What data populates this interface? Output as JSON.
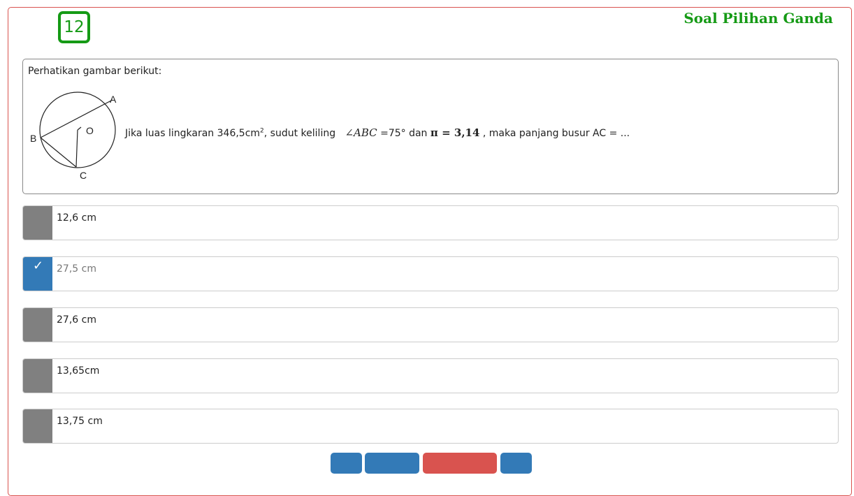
{
  "question": {
    "number": "12",
    "type_title": "Soal Pilihan Ganda",
    "intro": "Perhatikan gambar berikut:",
    "figure_labels": {
      "a": "A",
      "b": "B",
      "c": "C",
      "o": "O"
    },
    "text_part1": "Jika luas lingkaran 346,5cm",
    "superscript": "2",
    "text_part2": ", sudut keliling",
    "angle_expr": "∠ABC",
    "text_part3": "=75° dan",
    "pi_expr": "π = 3,14",
    "text_part4": ", maka panjang busur AC = ..."
  },
  "options": [
    {
      "label": "12,6 cm",
      "selected": false
    },
    {
      "label": "27,5 cm",
      "selected": true
    },
    {
      "label": "27,6 cm",
      "selected": false
    },
    {
      "label": "13,65cm",
      "selected": false
    },
    {
      "label": "13,75 cm",
      "selected": false
    }
  ],
  "check_glyph": "✓",
  "colors": {
    "accent_green": "#159a15",
    "frame_red": "#d9534f",
    "selected_blue": "#337ab7",
    "unselected_gray": "#808080"
  }
}
